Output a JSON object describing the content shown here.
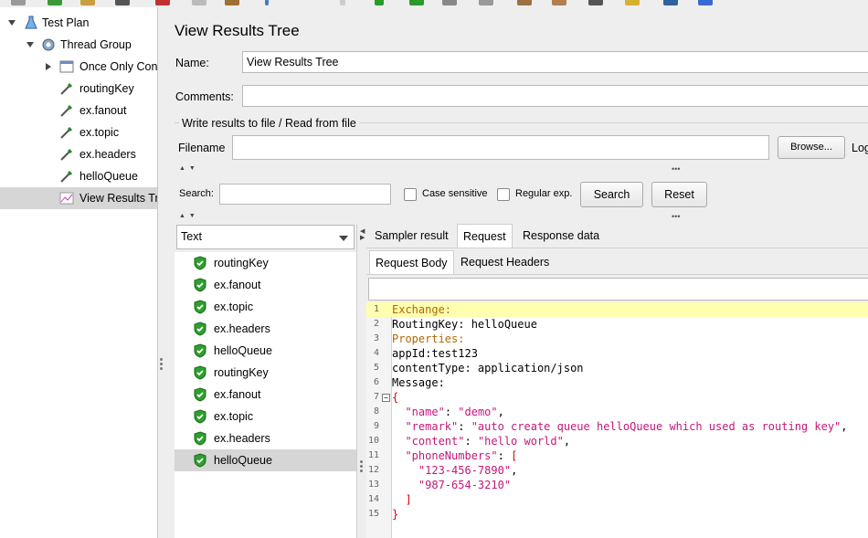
{
  "tree": {
    "items": [
      {
        "label": "Test Plan",
        "icon": "flask-icon"
      },
      {
        "label": "Thread Group",
        "icon": "gear-icon"
      },
      {
        "label": "Once Only Cont",
        "icon": "controller-icon"
      },
      {
        "label": "routingKey",
        "icon": "dropper-icon"
      },
      {
        "label": "ex.fanout",
        "icon": "dropper-icon"
      },
      {
        "label": "ex.topic",
        "icon": "dropper-icon"
      },
      {
        "label": "ex.headers",
        "icon": "dropper-icon"
      },
      {
        "label": "helloQueue",
        "icon": "dropper-icon"
      },
      {
        "label": "View Results Tr",
        "icon": "graph-icon"
      }
    ],
    "selected_index": 8
  },
  "main": {
    "title": "View Results Tree",
    "name_label": "Name:",
    "name_value": "View Results Tree",
    "comments_label": "Comments:",
    "comments_value": "",
    "write_results_label": "Write results to file / Read from file",
    "filename_label": "Filename",
    "filename_value": "",
    "browse_label": "Browse...",
    "log_label": "Log"
  },
  "search": {
    "label": "Search:",
    "value": "",
    "case_sensitive_label": "Case sensitive",
    "case_sensitive_checked": false,
    "regex_label": "Regular exp.",
    "regex_checked": false,
    "search_button": "Search",
    "reset_button": "Reset"
  },
  "renderer": {
    "selected": "Text"
  },
  "results": {
    "items": [
      "routingKey",
      "ex.fanout",
      "ex.topic",
      "ex.headers",
      "helloQueue",
      "routingKey",
      "ex.fanout",
      "ex.topic",
      "ex.headers",
      "helloQueue"
    ],
    "selected_index": 9,
    "status_color": "#2ea02e"
  },
  "tabs": {
    "top": [
      "Sampler result",
      "Request",
      "Response data"
    ],
    "top_active": 1,
    "sub": [
      "Request Body",
      "Request Headers"
    ],
    "sub_active": 0
  },
  "code": {
    "lines": [
      {
        "n": "1",
        "text": "Exchange:"
      },
      {
        "n": "2",
        "text": "RoutingKey: helloQueue"
      },
      {
        "n": "3",
        "text": "Properties:"
      },
      {
        "n": "4",
        "text": "appId:test123"
      },
      {
        "n": "5",
        "text": "contentType: application/json"
      },
      {
        "n": "6",
        "text": "Message:"
      },
      {
        "n": "7",
        "text": "{"
      },
      {
        "n": "8",
        "text": "  \"name\": \"demo\","
      },
      {
        "n": "9",
        "text": "  \"remark\": \"auto create queue helloQueue which used as routing key\","
      },
      {
        "n": "10",
        "text": "  \"content\": \"hello world\","
      },
      {
        "n": "11",
        "text": "  \"phoneNumbers\": ["
      },
      {
        "n": "12",
        "text": "    \"123-456-7890\","
      },
      {
        "n": "13",
        "text": "    \"987-654-3210\""
      },
      {
        "n": "14",
        "text": "  ]"
      },
      {
        "n": "15",
        "text": "}"
      }
    ],
    "highlight_line": 1
  }
}
